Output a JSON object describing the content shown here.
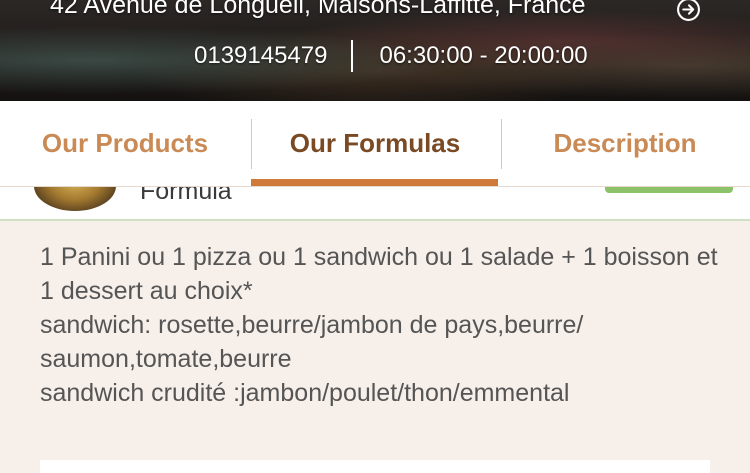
{
  "header": {
    "address": "42 Avenue de Longueil, Maisons-Laffitte, France",
    "phone": "0139145479",
    "hours": "06:30:00 - 20:00:00",
    "address_icon": "arrow-circle-right-icon"
  },
  "tabs": [
    {
      "label": "Our Products",
      "active": false
    },
    {
      "label": "Our Formulas",
      "active": true
    },
    {
      "label": "Description",
      "active": false
    }
  ],
  "formula": {
    "title": "Formula",
    "description": "1 Panini ou 1 pizza ou 1 sandwich ou 1 salade + 1 boisson et 1 dessert au choix*\nsandwich: rosette,beurre/jambon de pays,beurre/\nsaumon,tomate,beurre\nsandwich crudité :jambon/poulet/thon/emmental"
  },
  "colors": {
    "accent": "#cf7a3a",
    "tab_text": "#c98a55",
    "tab_active_text": "#7a4a24",
    "badge": "#8cc26a",
    "background": "#f6efea"
  }
}
